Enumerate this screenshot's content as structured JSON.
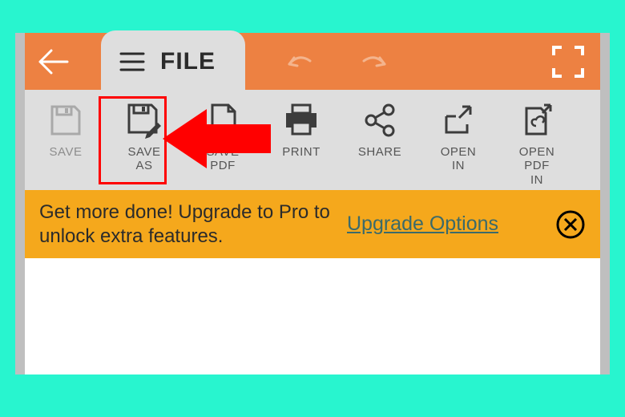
{
  "header": {
    "tab_label": "FILE"
  },
  "toolbar": {
    "save_label": "SAVE",
    "save_as_label": "SAVE\nAS",
    "save_pdf_label": "SAVE\nPDF",
    "print_label": "PRINT",
    "share_label": "SHARE",
    "open_in_label": "OPEN\nIN",
    "open_pdf_in_label": "OPEN\nPDF\nIN"
  },
  "banner": {
    "text": "Get more done! Upgrade to Pro to unlock extra features.",
    "link_label": "Upgrade Options"
  }
}
